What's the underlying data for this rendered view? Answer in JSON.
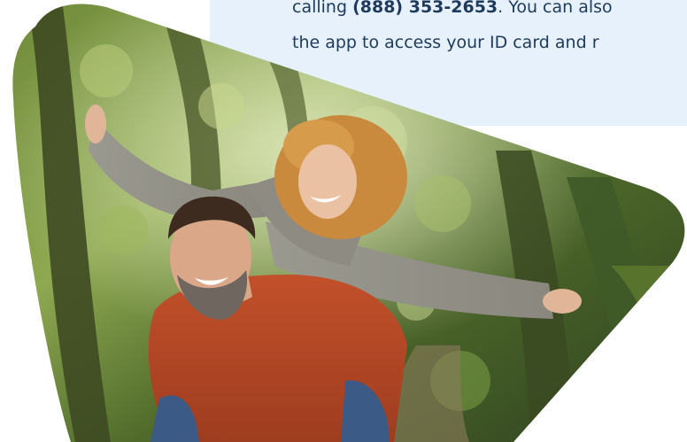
{
  "info": {
    "line1_prefix": "calling ",
    "phone": "(888) 353-2653",
    "line1_suffix": ". You can also",
    "line2": "the app to access your ID card and r"
  },
  "colors": {
    "card_background": "#e6f1fb",
    "text": "#1e3a5c"
  },
  "photo": {
    "subject": "couple-piggyback-forest-photo"
  }
}
